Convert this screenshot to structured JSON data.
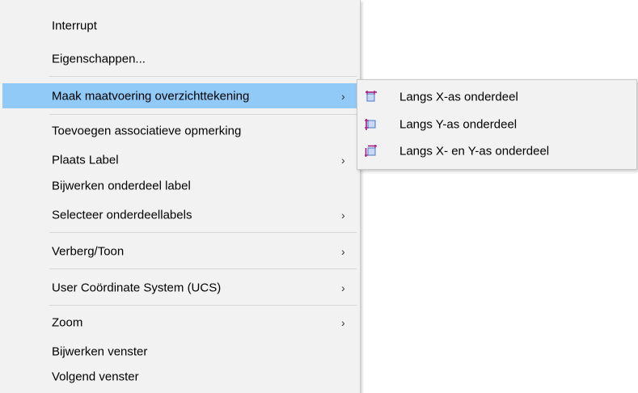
{
  "context_menu": {
    "items": [
      {
        "label": "Interrupt"
      },
      {
        "label": "Eigenschappen..."
      },
      {
        "label": "Maak maatvoering overzichttekening",
        "arrow": "›"
      },
      {
        "label": "Toevoegen associatieve opmerking"
      },
      {
        "label": "Plaats Label",
        "arrow": "›"
      },
      {
        "label": "Bijwerken onderdeel label"
      },
      {
        "label": "Selecteer onderdeellabels",
        "arrow": "›"
      },
      {
        "label": "Verberg/Toon",
        "arrow": "›"
      },
      {
        "label": "User Coördinate System (UCS)",
        "arrow": "›"
      },
      {
        "label": "Zoom",
        "arrow": "›"
      },
      {
        "label": "Bijwerken venster"
      },
      {
        "label": "Volgend venster"
      }
    ],
    "highlighted_item": "Maak maatvoering overzichttekening"
  },
  "submenu": {
    "items": [
      {
        "label": "Langs X-as onderdeel",
        "icon": "dimension-x-icon"
      },
      {
        "label": "Langs Y-as onderdeel",
        "icon": "dimension-y-icon"
      },
      {
        "label": "Langs X- en Y-as onderdeel",
        "icon": "dimension-xy-icon"
      }
    ]
  },
  "colors": {
    "menu_background": "#f2f2f2",
    "highlight": "#91c9f7",
    "separator": "#d7d7d7",
    "icon_magenta": "#a0127a",
    "icon_blue": "#4a78c8"
  }
}
